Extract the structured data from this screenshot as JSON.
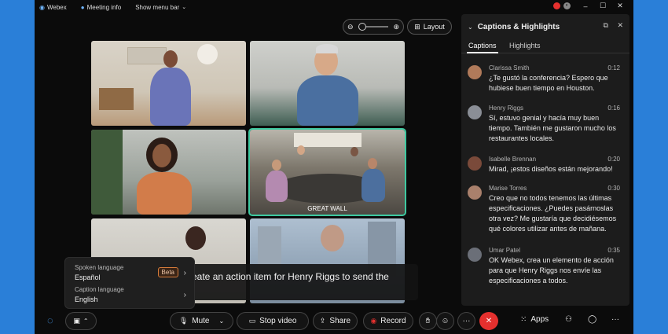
{
  "titlebar": {
    "app_name": "Webex",
    "meeting_info": "Meeting info",
    "show_menu_bar": "Show menu bar"
  },
  "view": {
    "layout_label": "Layout"
  },
  "tiles": [
    {
      "name": ""
    },
    {
      "name": ""
    },
    {
      "name": ""
    },
    {
      "name": "GREAT WALL"
    },
    {
      "name": ""
    },
    {
      "name": ""
    }
  ],
  "panel": {
    "title": "Captions & Highlights",
    "tabs": [
      {
        "label": "Captions",
        "selected": true
      },
      {
        "label": "Highlights",
        "selected": false
      }
    ],
    "captions": [
      {
        "speaker": "Clarissa Smith",
        "time": "0:12",
        "text": "¿Te gustó la conferencia? Espero que hubiese buen tiempo en Houston.",
        "avatar_color": "#b07a5a"
      },
      {
        "speaker": "Henry Riggs",
        "time": "0:16",
        "text": "Sí, estuvo genial y hacía muy buen tiempo. También me gustaron mucho los restaurantes locales.",
        "avatar_color": "#8a8e96"
      },
      {
        "speaker": "Isabelle Brennan",
        "time": "0:20",
        "text": "Mirad, ¡estos diseños están mejorando!",
        "avatar_color": "#7a4a3a"
      },
      {
        "speaker": "Marise Torres",
        "time": "0:30",
        "text": "Creo que no todos tenemos las últimas especificaciones. ¿Puedes pasárnoslas otra vez? Me gustaría que decidiésemos qué colores utilizar antes de mañana.",
        "avatar_color": "#a9806c"
      },
      {
        "speaker": "Umar Patel",
        "time": "0:35",
        "text": "OK Webex, crea un elemento de acción para que Henry Riggs nos envíe las especificaciones a todos.",
        "avatar_color": "#6b6f78"
      }
    ]
  },
  "live_caption": {
    "text": "eate an action item for Henry Riggs to send the"
  },
  "language_popup": {
    "spoken_label": "Spoken language",
    "spoken_value": "Español",
    "beta_badge": "Beta",
    "caption_label": "Caption language",
    "caption_value": "English"
  },
  "controls": {
    "mute": "Mute",
    "stop_video": "Stop video",
    "share": "Share",
    "record": "Record",
    "apps": "Apps",
    "more": "···"
  },
  "colors": {
    "accent_active": "#3ec9a0",
    "end_call": "#e5302e",
    "record_dot": "#e5302e"
  }
}
